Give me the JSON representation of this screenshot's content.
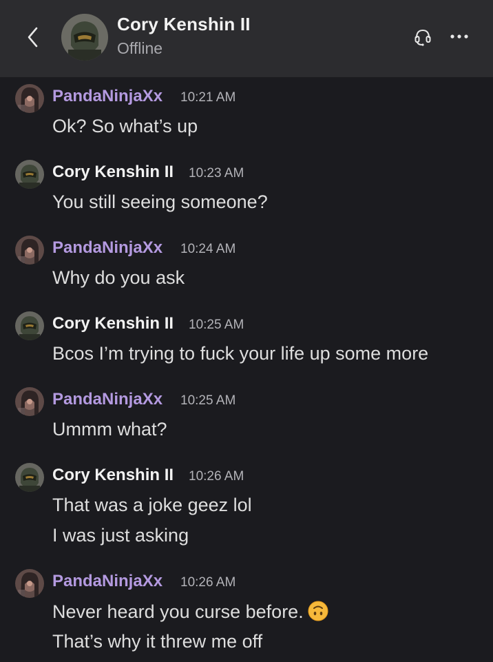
{
  "header": {
    "contact_name": "Cory Kenshin II",
    "status": "Offline"
  },
  "colors": {
    "background": "#1b1b1f",
    "header_background": "#2c2c2f",
    "panda_name": "#b49ae0",
    "cory_name": "#f2f2f2",
    "timestamp": "#b3b3b8",
    "message_text": "#dedede"
  },
  "messages": [
    {
      "author": "PandaNinjaXx",
      "time": "10:21 AM",
      "lines": [
        "Ok? So what’s up"
      ]
    },
    {
      "author": "Cory Kenshin II",
      "time": "10:23 AM",
      "lines": [
        "You still seeing someone?"
      ]
    },
    {
      "author": "PandaNinjaXx",
      "time": "10:24 AM",
      "lines": [
        "Why do you ask"
      ]
    },
    {
      "author": "Cory Kenshin II",
      "time": "10:25 AM",
      "lines": [
        "Bcos I’m trying to fuck your life up some more"
      ]
    },
    {
      "author": "PandaNinjaXx",
      "time": "10:25 AM",
      "lines": [
        "Ummm what?"
      ]
    },
    {
      "author": "Cory Kenshin II",
      "time": "10:26 AM",
      "lines": [
        "That was a joke geez lol",
        "I was just asking"
      ]
    },
    {
      "author": "PandaNinjaXx",
      "time": "10:26 AM",
      "lines": [
        "Never heard you curse before.",
        "That’s why it threw me off"
      ]
    }
  ],
  "icons": {
    "back": "chevron-left-icon",
    "voice": "headset-icon",
    "more": "more-horizontal-icon",
    "emoji": "upside-down-face-emoji"
  }
}
